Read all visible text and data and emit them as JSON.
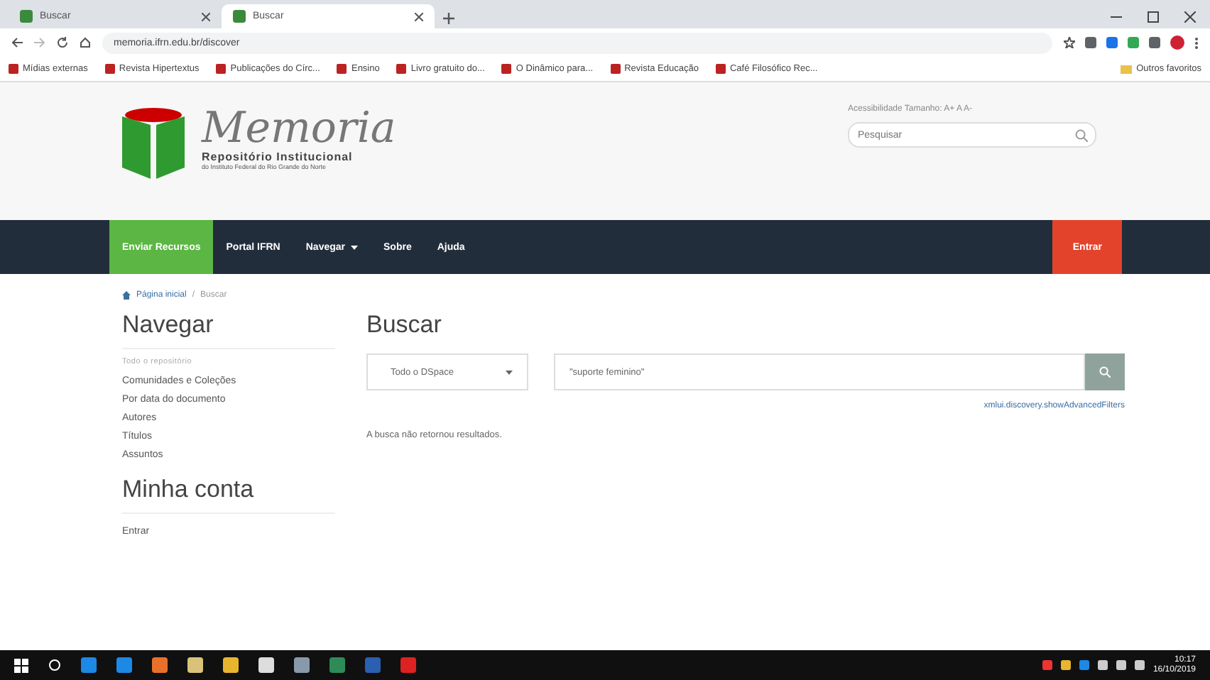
{
  "browser": {
    "tabs": [
      {
        "title": "Buscar",
        "selected": false
      },
      {
        "title": "Buscar",
        "selected": true
      }
    ],
    "url": "memoria.ifrn.edu.br/discover",
    "bookmarks": [
      "Mídias externas",
      "Revista Hipertextus",
      "Publicações do Círc...",
      "Ensino",
      "Livro gratuito do...",
      "O Dinâmico para...",
      "Revista Educação",
      "Café Filosófico Rec..."
    ],
    "other_bookmarks": "Outros favoritos"
  },
  "header": {
    "logo_title": "Memoria",
    "logo_subtitle": "Repositório Institucional",
    "logo_caption": "do Instituto Federal do Rio Grande do Norte",
    "accessibility": "Acessibilidade  Tamanho: A+ A A-",
    "search": {
      "placeholder": "Pesquisar"
    }
  },
  "nav": {
    "items": [
      {
        "label": "Enviar Recursos",
        "selected": true,
        "dropdown": false
      },
      {
        "label": "Portal IFRN",
        "selected": false,
        "dropdown": false
      },
      {
        "label": "Navegar",
        "selected": false,
        "dropdown": true
      },
      {
        "label": "Sobre",
        "selected": false,
        "dropdown": false
      },
      {
        "label": "Ajuda",
        "selected": false,
        "dropdown": false
      }
    ],
    "login": "Entrar"
  },
  "breadcrumb": [
    "Página inicial",
    "Buscar"
  ],
  "breadcrumb_separator": "/",
  "sidebar": {
    "sections": [
      {
        "title": "Navegar",
        "subtitle": "Todo o repositório",
        "items": [
          "Comunidades e Coleções",
          "Por data do documento",
          "Autores",
          "Títulos",
          "Assuntos"
        ]
      },
      {
        "title": "Minha conta",
        "items": [
          "Entrar"
        ]
      }
    ]
  },
  "main": {
    "title": "Buscar",
    "scope": "Todo o DSpace",
    "query": "\"suporte feminino\"",
    "advanced_link": "xmlui.discovery.showAdvancedFilters",
    "result": "A busca não retornou resultados."
  },
  "taskbar": {
    "time": "10:17",
    "date": "16/10/2019"
  }
}
